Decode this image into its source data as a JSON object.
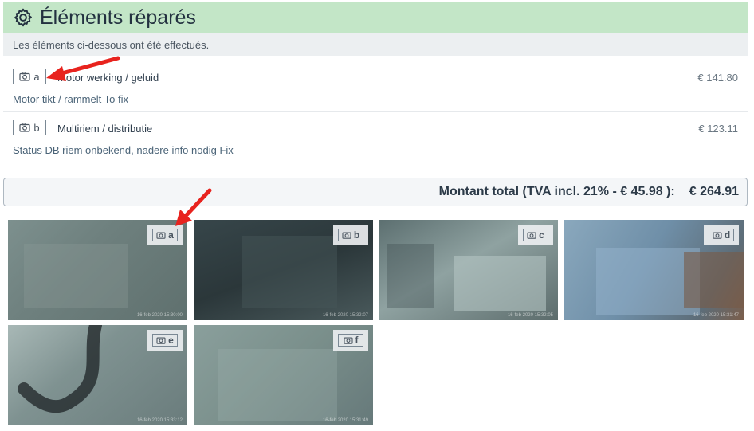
{
  "header": {
    "title": "Éléments réparés",
    "icon": "gear-icon"
  },
  "subheader": {
    "text": "Les éléments ci-dessous ont été effectués."
  },
  "items": [
    {
      "tag": "a",
      "title": "Motor werking / geluid",
      "price": "€ 141.80",
      "description": "Motor tikt / rammelt To fix"
    },
    {
      "tag": "b",
      "title": "Multiriem / distributie",
      "price": "€ 123.11",
      "description": "Status DB riem onbekend, nadere info nodig Fix"
    }
  ],
  "total": {
    "label": "Montant total (TVA incl. 21% - € 45.98 ):",
    "value": "€ 264.91"
  },
  "photos": [
    {
      "tag": "a"
    },
    {
      "tag": "b"
    },
    {
      "tag": "c"
    },
    {
      "tag": "d"
    },
    {
      "tag": "e"
    },
    {
      "tag": "f"
    }
  ],
  "colors": {
    "header_bg": "#c3e6c7",
    "subheader_bg": "#eceff1",
    "arrow": "#e8231e"
  }
}
